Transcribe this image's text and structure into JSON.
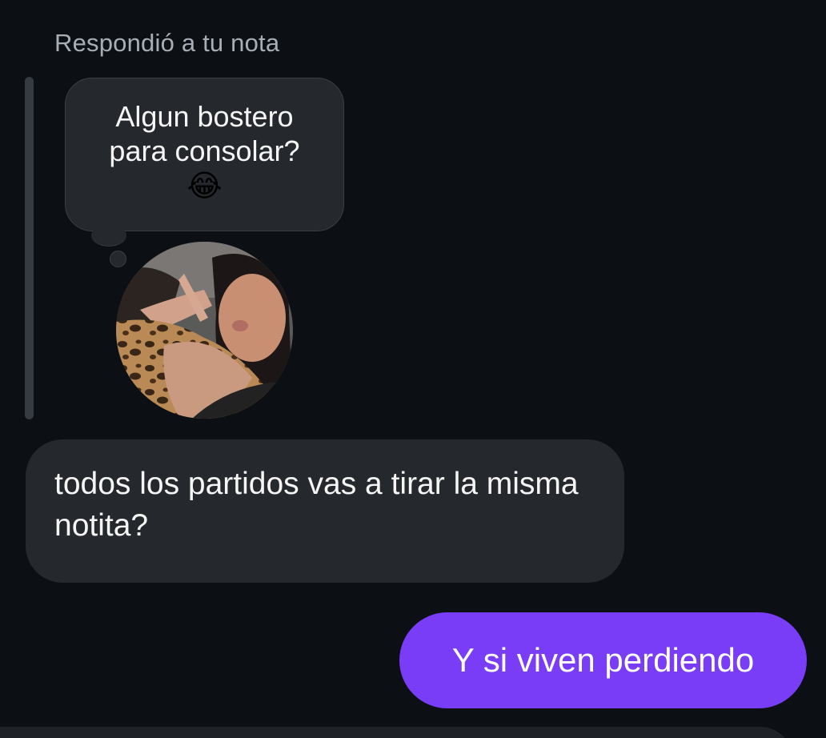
{
  "thread": {
    "reply_context": "Respondió a tu nota",
    "note": {
      "text": "Algun bostero para consolar?",
      "emoji": "😂"
    },
    "avatar": {
      "icon": "profile-photo-avatar"
    },
    "messages": [
      {
        "direction": "incoming",
        "text": "todos los partidos vas a tirar la misma notita?"
      },
      {
        "direction": "outgoing",
        "text": "Y si viven perdiendo"
      }
    ]
  },
  "colors": {
    "background": "#0c1014",
    "incoming_bubble": "#25292e",
    "outgoing_bubble": "#7a3df7",
    "muted_text": "#a8aeb6"
  }
}
